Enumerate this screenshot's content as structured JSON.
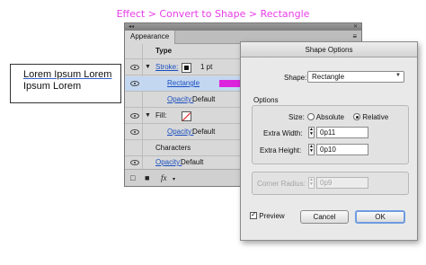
{
  "caption": "Effect > Convert to Shape > Rectangle",
  "textbox": {
    "line1": "Lorem Ipsum Lorem",
    "line2": "Ipsum Lorem"
  },
  "panel": {
    "tab": "Appearance",
    "header_type": "Type",
    "rows": {
      "stroke_label": "Stroke:",
      "stroke_weight": "1 pt",
      "rectangle": "Rectangle",
      "opacity1_label": "Opacity:",
      "opacity1_value": "Default",
      "fill_label": "Fill:",
      "characters": "Characters",
      "opacity2_label": "Opacity:",
      "opacity2_value": "Default"
    },
    "footer_fx": "fx"
  },
  "dialog": {
    "title": "Shape Options",
    "shape_label": "Shape:",
    "shape_value": "Rectangle",
    "options_group": "Options",
    "size_label": "Size:",
    "size_absolute": "Absolute",
    "size_relative": "Relative",
    "size_selected": "Relative",
    "extra_width_label": "Extra Width:",
    "extra_width_value": "0p11",
    "extra_height_label": "Extra Height:",
    "extra_height_value": "0p10",
    "corner_radius_label": "Corner Radius:",
    "corner_radius_value": "0p9",
    "preview_label": "Preview",
    "preview_checked": true,
    "cancel_label": "Cancel",
    "ok_label": "OK"
  },
  "colors": {
    "caption": "#e83de8",
    "arrow": "#dd22dd",
    "selection": "#c3d7f0",
    "link": "#1a4fc0"
  }
}
